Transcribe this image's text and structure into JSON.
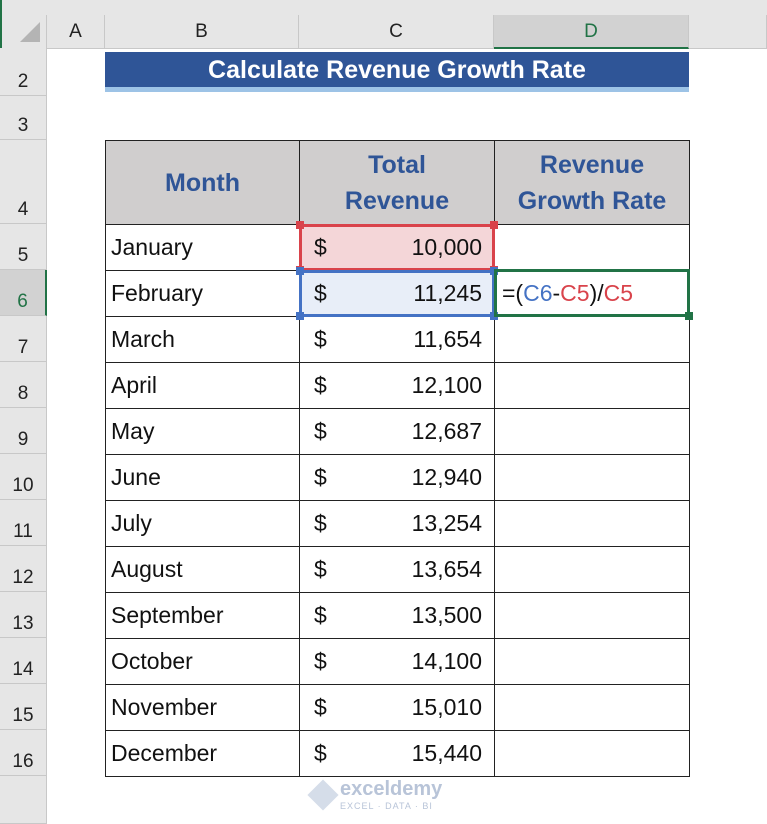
{
  "columns": [
    "A",
    "B",
    "C",
    "D"
  ],
  "rows": [
    "2",
    "3",
    "4",
    "5",
    "6",
    "7",
    "8",
    "9",
    "10",
    "11",
    "12",
    "13",
    "14",
    "15",
    "16"
  ],
  "title": "Calculate Revenue Growth Rate",
  "headers": {
    "month": "Month",
    "revenue": "Total Revenue",
    "growth": "Revenue Growth Rate"
  },
  "currency": "$",
  "table": [
    {
      "month": "January",
      "revenue": "10,000"
    },
    {
      "month": "February",
      "revenue": "11,245"
    },
    {
      "month": "March",
      "revenue": "11,654"
    },
    {
      "month": "April",
      "revenue": "12,100"
    },
    {
      "month": "May",
      "revenue": "12,687"
    },
    {
      "month": "June",
      "revenue": "12,940"
    },
    {
      "month": "July",
      "revenue": "13,254"
    },
    {
      "month": "August",
      "revenue": "13,654"
    },
    {
      "month": "September",
      "revenue": "13,500"
    },
    {
      "month": "October",
      "revenue": "14,100"
    },
    {
      "month": "November",
      "revenue": "15,010"
    },
    {
      "month": "December",
      "revenue": "15,440"
    }
  ],
  "formula": {
    "p1": "=(",
    "r1": "C6",
    "p2": "-",
    "r2": "C5",
    "p3": ")/",
    "r3": "C5"
  },
  "colors": {
    "title_bg": "#2f5597",
    "header_text": "#2f5597",
    "ref_blue": "#4472c4",
    "ref_red": "#d9434b",
    "active_green": "#217346"
  },
  "watermark": {
    "name": "exceldemy",
    "tagline": "EXCEL · DATA · BI"
  }
}
